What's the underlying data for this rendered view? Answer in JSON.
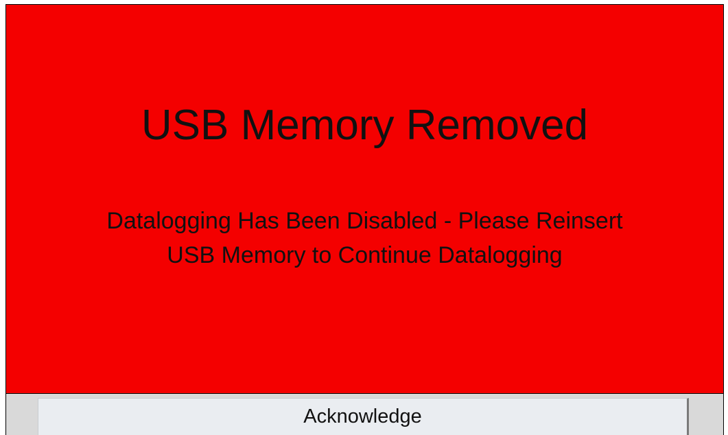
{
  "alarm": {
    "title": "USB Memory Removed",
    "message_line1": "Datalogging Has Been Disabled - Please Reinsert",
    "message_line2": "USB Memory to Continue Datalogging",
    "background_color": "#f40000"
  },
  "actions": {
    "acknowledge_label": "Acknowledge"
  }
}
